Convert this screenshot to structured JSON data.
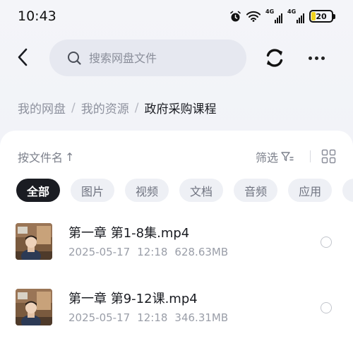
{
  "status_bar": {
    "time": "10:43",
    "net1_label": "4G",
    "net2_label": "4G",
    "battery_level": "20",
    "battery_color": "#f2d31b"
  },
  "header": {
    "back_icon": "chevron-left-icon",
    "search_placeholder": "搜索网盘文件",
    "search_icon": "search-icon",
    "sync_icon": "sync-icon",
    "more_icon": "more-dots-icon"
  },
  "breadcrumb": {
    "items": [
      "我的网盘",
      "我的资源",
      "政府采购课程"
    ],
    "separator": "/"
  },
  "toolbar": {
    "sort_label": "按文件名",
    "sort_arrow": "↑",
    "filter_label": "筛选",
    "filter_icon": "filter-icon",
    "view_icon": "grid-view-icon"
  },
  "chips": [
    "全部",
    "图片",
    "视频",
    "文档",
    "音频",
    "应用"
  ],
  "active_chip": "全部",
  "files": [
    {
      "name": "第一章 第1-8集.mp4",
      "date": "2025-05-17",
      "time": "12:18",
      "size": "628.63MB",
      "thumb_icon": "video-thumbnail"
    },
    {
      "name": "第一章 第9-12课.mp4",
      "date": "2025-05-17",
      "time": "12:18",
      "size": "346.31MB",
      "thumb_icon": "video-thumbnail"
    }
  ],
  "colors": {
    "accent_dark": "#1a1c22",
    "muted_text": "#8d919d",
    "chip_bg": "#eef0f5",
    "search_bg": "#e6e8f0"
  }
}
